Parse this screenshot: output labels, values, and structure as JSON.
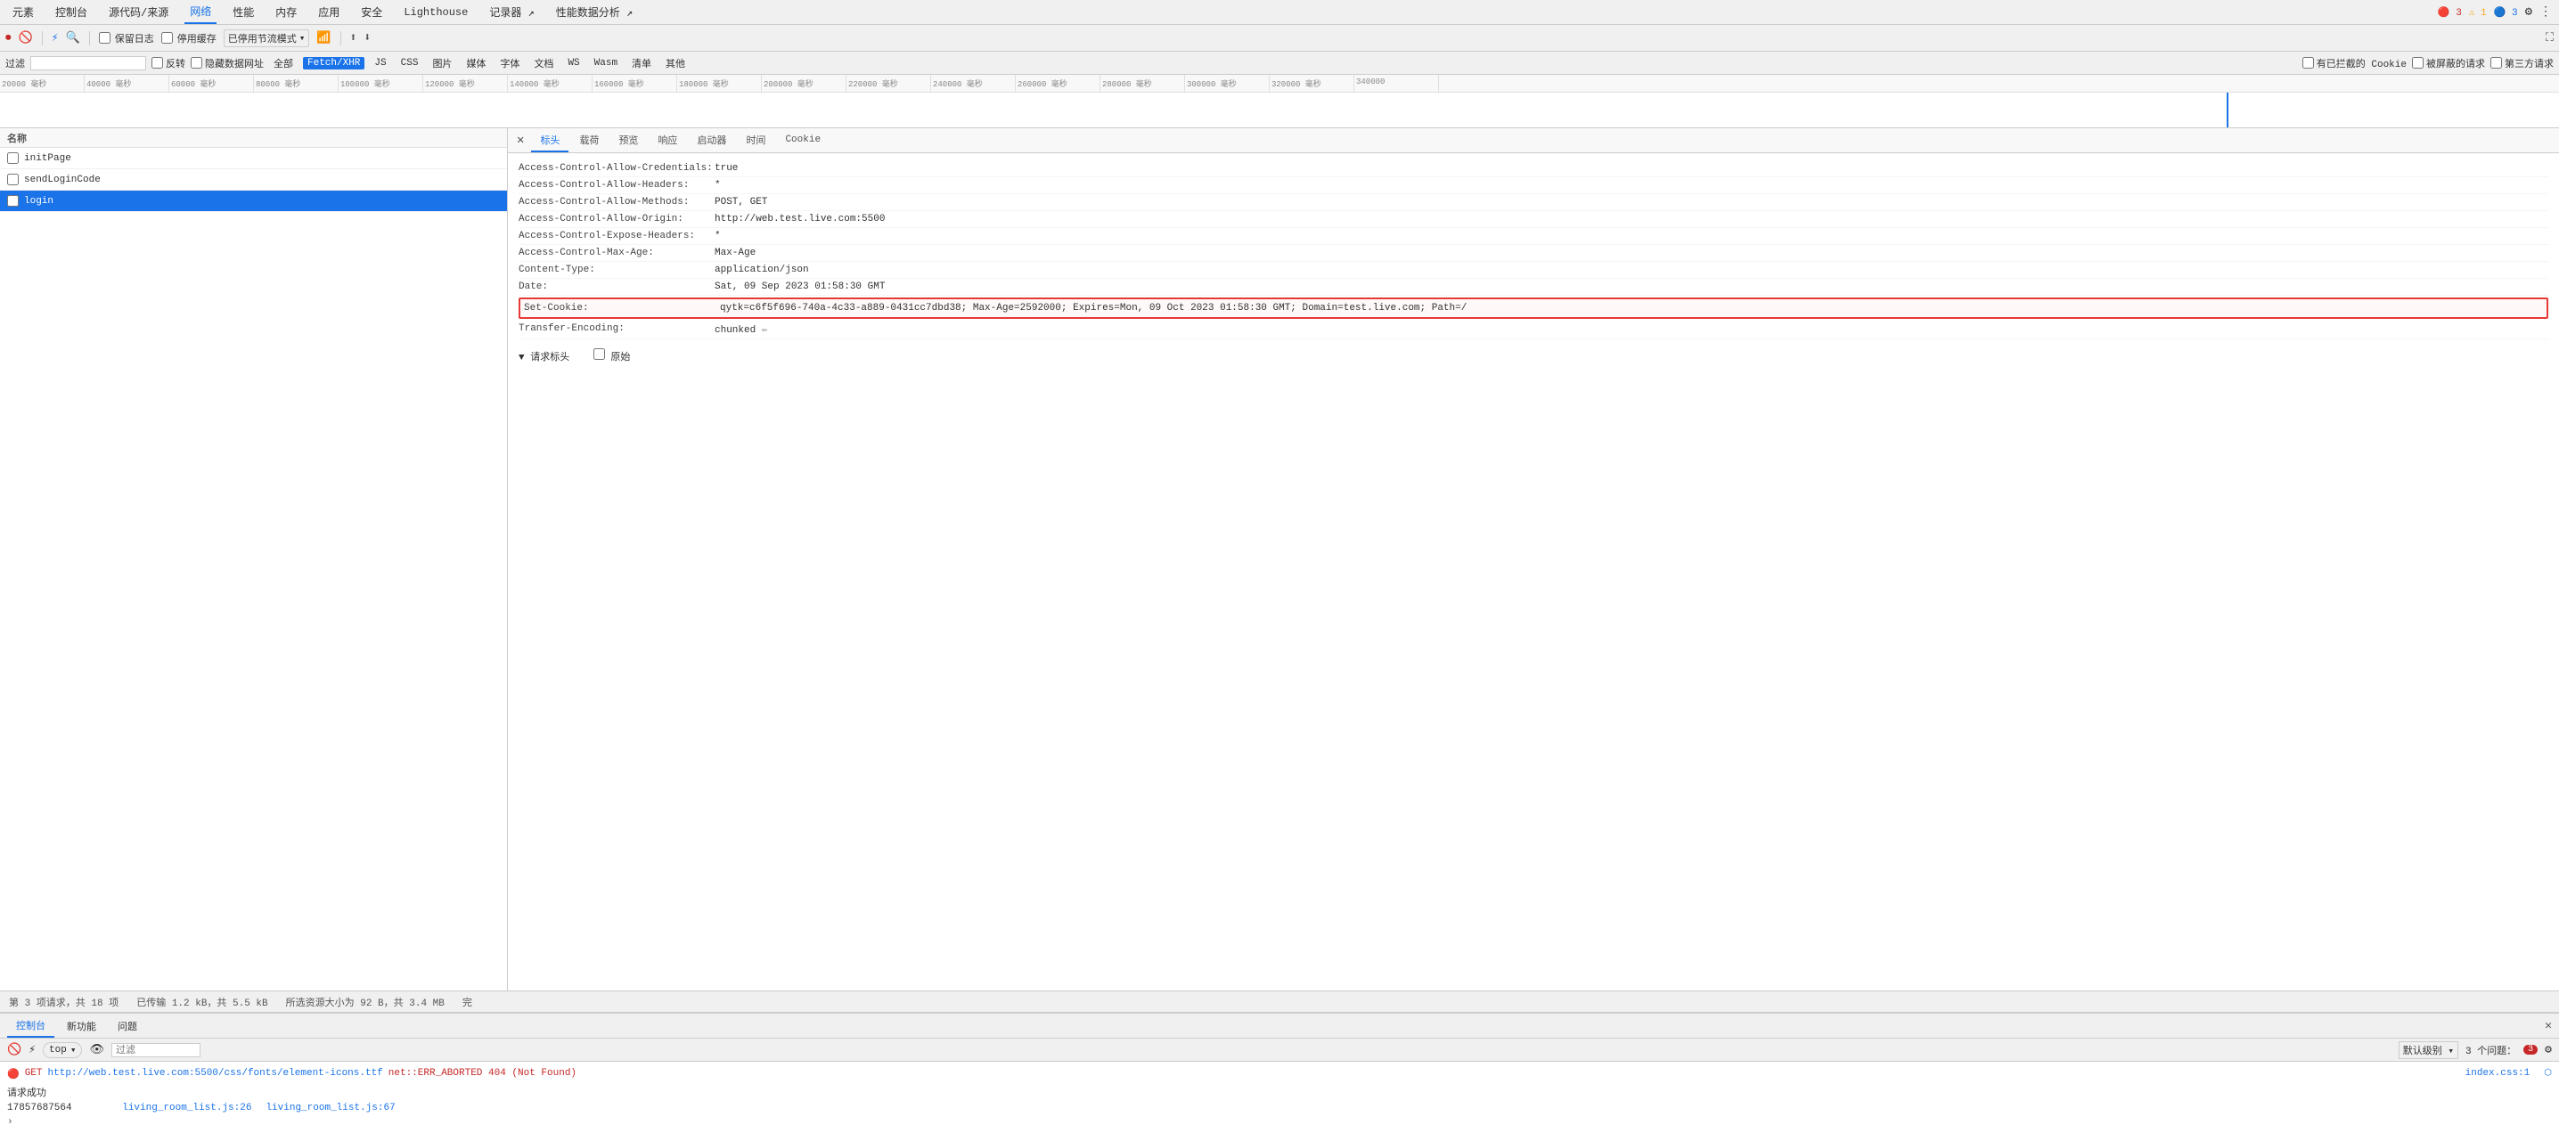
{
  "topnav": {
    "items": [
      "元素",
      "控制台",
      "源代码/来源",
      "网络",
      "性能",
      "内存",
      "应用",
      "安全",
      "Lighthouse",
      "记录器",
      "性能数据分析"
    ],
    "active": "网络",
    "badges": {
      "errors": "3",
      "warnings": "1",
      "info": "3"
    },
    "settings_icon": "⚙",
    "more_icon": "⋮",
    "close_icon": "✕"
  },
  "toolbar": {
    "record_icon": "⏺",
    "clear_icon": "🚫",
    "filter_icon": "⚡",
    "search_icon": "🔍",
    "preserve_log": "保留日志",
    "disable_cache": "停用缓存",
    "disable_throttle": "已停用节流模式",
    "upload_icon": "⬆",
    "download_icon": "⬇"
  },
  "filterbar": {
    "filter_label": "过滤",
    "invert": "反转",
    "hide_data_urls": "隐藏数据网址",
    "all": "全部",
    "tabs": [
      "Fetch/XHR",
      "JS",
      "CSS",
      "图片",
      "媒体",
      "字体",
      "文档",
      "WS",
      "Wasm",
      "清单",
      "其他"
    ],
    "active_tab": "Fetch/XHR",
    "blocked_cookies": "有已拦截的 Cookie",
    "blocked_requests": "被屏蔽的请求",
    "third_party": "第三方请求"
  },
  "timeline": {
    "ticks": [
      "20000 毫秒",
      "40000 毫秒",
      "60000 毫秒",
      "80000 毫秒",
      "100000 毫秒",
      "120000 毫秒",
      "140000 毫秒",
      "160000 毫秒",
      "180000 毫秒",
      "200000 毫秒",
      "220000 毫秒",
      "240000 毫秒",
      "260000 毫秒",
      "280000 毫秒",
      "300000 毫秒",
      "320000 毫秒",
      "340000"
    ]
  },
  "list_header": "名称",
  "request_list": [
    {
      "name": "initPage",
      "selected": false
    },
    {
      "name": "sendLoginCode",
      "selected": false
    },
    {
      "name": "login",
      "selected": true
    }
  ],
  "details": {
    "close_icon": "✕",
    "tabs": [
      "标头",
      "载荷",
      "预览",
      "响应",
      "启动器",
      "时间",
      "Cookie"
    ],
    "active_tab": "标头",
    "headers": [
      {
        "name": "Access-Control-Allow-Credentials:",
        "value": "true",
        "highlighted": false
      },
      {
        "name": "Access-Control-Allow-Headers:",
        "value": "*",
        "highlighted": false
      },
      {
        "name": "Access-Control-Allow-Methods:",
        "value": "POST, GET",
        "highlighted": false
      },
      {
        "name": "Access-Control-Allow-Origin:",
        "value": "http://web.test.live.com:5500",
        "highlighted": false
      },
      {
        "name": "Access-Control-Expose-Headers:",
        "value": "*",
        "highlighted": false
      },
      {
        "name": "Access-Control-Max-Age:",
        "value": "Max-Age",
        "highlighted": false
      },
      {
        "name": "Content-Type:",
        "value": "application/json",
        "highlighted": false
      },
      {
        "name": "Date:",
        "value": "Sat, 09 Sep 2023 01:58:30 GMT",
        "highlighted": false
      },
      {
        "name": "Set-Cookie:",
        "value": "qytk=c6f5f696-740a-4c33-a889-0431cc7dbd38; Max-Age=2592000; Expires=Mon, 09 Oct 2023 01:58:30 GMT; Domain=test.live.com; Path=/",
        "highlighted": true
      },
      {
        "name": "Transfer-Encoding:",
        "value": "chunked",
        "edit_icon": true,
        "highlighted": false
      }
    ],
    "request_headers_section": "▼ 请求标头",
    "raw_checkbox": "原始"
  },
  "statusbar": {
    "requests": "第 3 项请求，共 18 项",
    "transferred": "已传输 1.2 kB，共 5.5 kB",
    "resource_size": "所选资源大小为 92 B，共 3.4 MB",
    "finish": "完"
  },
  "console": {
    "tabs": [
      "控制台",
      "新功能",
      "问题"
    ],
    "active_tab": "控制台",
    "toolbar": {
      "target": "top",
      "eye_icon": "👁",
      "filter_label": "过滤",
      "default_level": "默认级别",
      "issues_badge": "3 个问题：",
      "issues_count": "3",
      "settings_icon": "⚙",
      "close_icon": "✕"
    },
    "messages": [
      {
        "type": "error",
        "text": "GET http://web.test.live.com:5500/css/fonts/element-icons.ttf net::ERR_ABORTED 404 (Not Found)",
        "link": "index.css:1",
        "link2": ""
      }
    ],
    "console_messages": [
      {
        "text": "请求成功",
        "type": "info"
      },
      {
        "text": "17857687564",
        "type": "info"
      }
    ],
    "right_links": [
      "index.css:1",
      "living_room_list.js:26",
      "living_room_list.js:67"
    ],
    "chevron": ">",
    "input_placeholder": ""
  }
}
